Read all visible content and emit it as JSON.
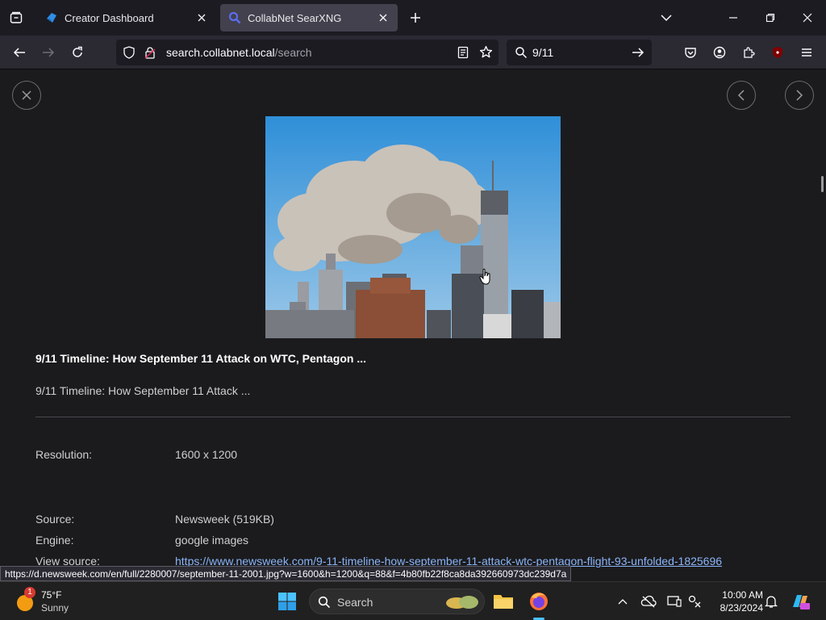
{
  "browser": {
    "tabs": [
      {
        "title": "Creator Dashboard",
        "active": false
      },
      {
        "title": "CollabNet SearXNG",
        "active": true
      }
    ],
    "url": {
      "host": "search.collabnet.local",
      "path": "/search"
    },
    "search_query": "9/11"
  },
  "viewer": {
    "title": "9/11 Timeline: How September 11 Attack on WTC, Pentagon ...",
    "description": "9/11 Timeline: How September 11 Attack ...",
    "details": [
      {
        "label": "Resolution:",
        "value": "1600 x 1200",
        "is_link": false
      },
      {
        "label": "Source:",
        "value": "Newsweek (519KB)",
        "is_link": false
      },
      {
        "label": "Engine:",
        "value": "google images",
        "is_link": false
      },
      {
        "label": "View source:",
        "value": "https://www.newsweek.com/9-11-timeline-how-september-11-attack-wtc-pentagon-flight-93-unfolded-1825696",
        "is_link": true
      }
    ]
  },
  "status_url": "https://d.newsweek.com/en/full/2280007/september-11-2001.jpg?w=1600&h=1200&q=88&f=4b80fb22f8ca8da392660973dc239d7a",
  "taskbar": {
    "weather": {
      "temp": "75°F",
      "condition": "Sunny",
      "badge": "1"
    },
    "search_placeholder": "Search",
    "time": "10:00 AM",
    "date": "8/23/2024"
  },
  "colors": {
    "accent": "#8ab4f8",
    "tab_active": "#42414d",
    "toolbar": "#2b2a33"
  }
}
